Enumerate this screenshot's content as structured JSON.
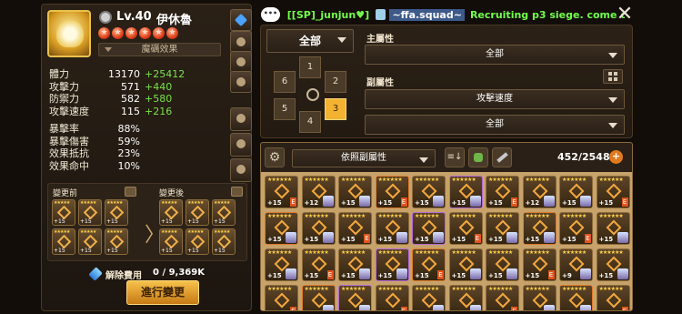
{
  "monster": {
    "level": "Lv.40",
    "name": "伊休魯",
    "stars": [
      "★",
      "★",
      "★",
      "★",
      "★",
      "★"
    ],
    "rune_effect_label": "魔礪效果"
  },
  "stats": [
    {
      "label": "體力",
      "value": "13170",
      "bonus": "+25412"
    },
    {
      "label": "攻擊力",
      "value": "571",
      "bonus": "+440"
    },
    {
      "label": "防禦力",
      "value": "582",
      "bonus": "+580"
    },
    {
      "label": "攻擊速度",
      "value": "115",
      "bonus": "+216"
    },
    {
      "label": "暴擊率",
      "value": "88%",
      "bonus": ""
    },
    {
      "label": "暴擊傷害",
      "value": "59%",
      "bonus": ""
    },
    {
      "label": "效果抵抗",
      "value": "23%",
      "bonus": ""
    },
    {
      "label": "效果命中",
      "value": "10%",
      "bonus": ""
    }
  ],
  "change": {
    "before_label": "變更前",
    "after_label": "變更後",
    "before_runes": [
      "+15",
      "+15",
      "+15",
      "+15",
      "+15",
      "+15"
    ],
    "after_runes": [
      "+15",
      "+15",
      "+15",
      "+15",
      "+15",
      "+15"
    ],
    "arrow": "〉"
  },
  "cost": {
    "label": "解除費用",
    "value": "0 / 9,369K"
  },
  "apply_button": "進行變更",
  "chat": {
    "bubble": "•••",
    "user": "[[SP]_junjun♥]",
    "tag": "~ffa.squad~",
    "message": "Recruiting p3 siege. come c"
  },
  "close_label": "✕",
  "filters": {
    "set_label": "全部",
    "slots": [
      "1",
      "2",
      "3",
      "4",
      "5",
      "6"
    ],
    "active_slot": "3",
    "main_stat_label": "主屬性",
    "main_stat_value": "全部",
    "sub_stat_label": "副屬性",
    "sub_stat_value_1": "攻擊速度",
    "sub_stat_value_2": "全部"
  },
  "inventory": {
    "gear_icon": "⚙",
    "sort_label": "依照副屬性",
    "count": "452/2548",
    "add_label": "+",
    "sort_order_icon": "≡↓",
    "runes": [
      "+15",
      "+12",
      "+15",
      "+15",
      "+15",
      "+15",
      "+15",
      "+12",
      "+15",
      "+15",
      "+15",
      "+15",
      "+15",
      "+15",
      "+15",
      "+15",
      "+15",
      "+15",
      "+15",
      "+15",
      "+15",
      "+15",
      "+15",
      "+15",
      "+15",
      "+15",
      "+15",
      "+15",
      "+9",
      "+15",
      "",
      "",
      "",
      "",
      "",
      "",
      "",
      "",
      "",
      ""
    ]
  },
  "colors": {
    "accent": "#f3b331",
    "bonus": "#79e34a",
    "chat_green": "#72ff4c"
  }
}
